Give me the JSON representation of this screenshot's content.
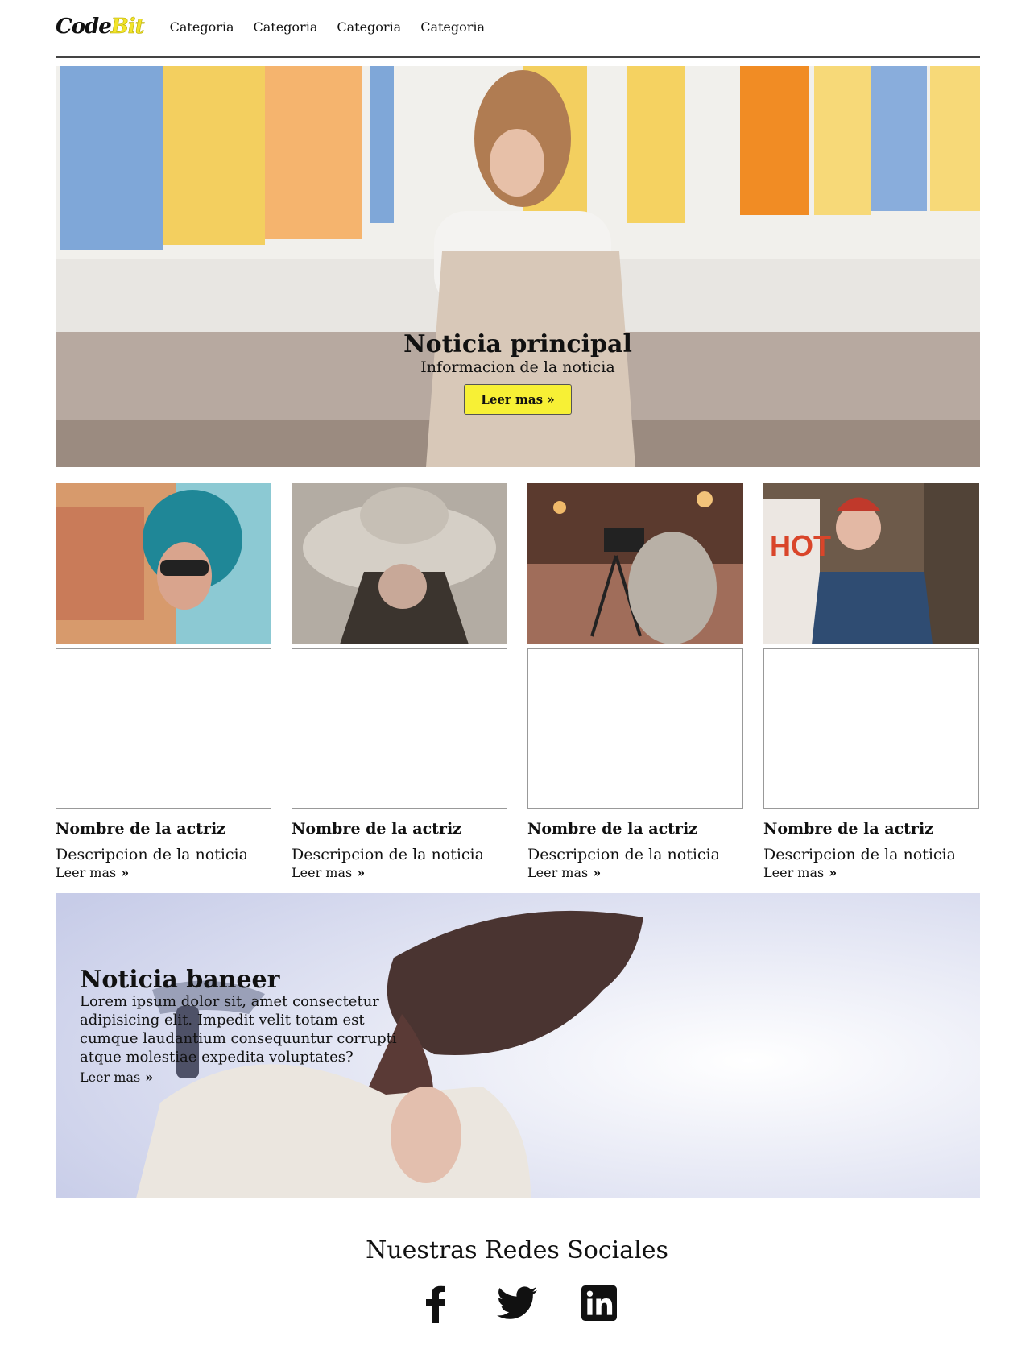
{
  "header": {
    "logo_part1": "Code",
    "logo_part2": "Bit",
    "nav": [
      "Categoria",
      "Categoria",
      "Categoria",
      "Categoria"
    ]
  },
  "hero": {
    "title": "Noticia principal",
    "subtitle": "Informacion de la noticia",
    "button_label": "Leer mas"
  },
  "cards": [
    {
      "name": "Nombre de la actriz",
      "description": "Descripcion de la noticia",
      "link": "Leer mas"
    },
    {
      "name": "Nombre de la actriz",
      "description": "Descripcion de la noticia",
      "link": "Leer mas"
    },
    {
      "name": "Nombre de la actriz",
      "description": "Descripcion de la noticia",
      "link": "Leer mas"
    },
    {
      "name": "Nombre de la actriz",
      "description": "Descripcion de la noticia",
      "link": "Leer mas"
    }
  ],
  "banner": {
    "title": "Noticia baneer",
    "body": "Lorem ipsum dolor sit, amet consectetur adipisicing elit. Impedit velit totam est cumque laudantium consequuntur corrupti atque molestiae expedita voluptates?",
    "link": "Leer mas"
  },
  "social": {
    "title": "Nuestras Redes Sociales",
    "icons": [
      "facebook-icon",
      "twitter-icon",
      "linkedin-icon"
    ]
  },
  "colors": {
    "accent": "#f7f035",
    "text": "#111111"
  }
}
